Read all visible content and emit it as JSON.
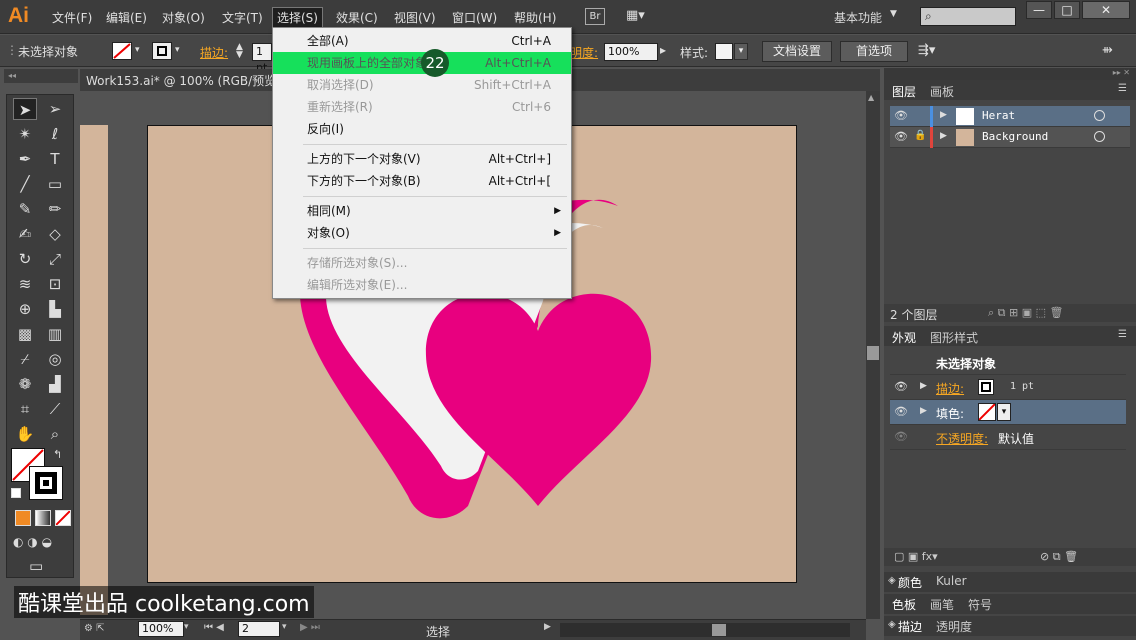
{
  "app": {
    "logo": "Ai"
  },
  "menubar": {
    "items": [
      "文件(F)",
      "编辑(E)",
      "对象(O)",
      "文字(T)",
      "选择(S)",
      "效果(C)",
      "视图(V)",
      "窗口(W)",
      "帮助(H)"
    ],
    "br_label": "Br",
    "workspace": "基本功能",
    "search_value": ""
  },
  "control": {
    "selection_label": "未选择对象",
    "stroke_label": "描边:",
    "stroke_value": "1 pt",
    "opacity_label": "不透明度:",
    "opacity_short": "明度:",
    "opacity_value": "100%",
    "style_label": "样式:",
    "doc_settings": "文档设置",
    "prefs": "首选项"
  },
  "document": {
    "title": "Work153.ai* @ 100% (RGB/预览"
  },
  "select_menu": {
    "items": [
      {
        "label": "全部(A)",
        "shortcut": "Ctrl+A",
        "state": "normal"
      },
      {
        "label": "现用画板上的全部对象(L)",
        "shortcut": "Alt+Ctrl+A",
        "state": "highlight"
      },
      {
        "label": "取消选择(D)",
        "shortcut": "Shift+Ctrl+A",
        "state": "disabled"
      },
      {
        "label": "重新选择(R)",
        "shortcut": "Ctrl+6",
        "state": "disabled"
      },
      {
        "label": "反向(I)",
        "shortcut": "",
        "state": "normal"
      },
      {
        "label": "上方的下一个对象(V)",
        "shortcut": "Alt+Ctrl+]",
        "state": "normal"
      },
      {
        "label": "下方的下一个对象(B)",
        "shortcut": "Alt+Ctrl+[",
        "state": "normal"
      },
      {
        "label": "相同(M)",
        "shortcut": "",
        "state": "submenu"
      },
      {
        "label": "对象(O)",
        "shortcut": "",
        "state": "submenu"
      },
      {
        "label": "存储所选对象(S)...",
        "shortcut": "",
        "state": "disabled"
      },
      {
        "label": "编辑所选对象(E)...",
        "shortcut": "",
        "state": "disabled"
      }
    ],
    "step_badge": "22"
  },
  "layers_panel": {
    "tabs": [
      "图层",
      "画板"
    ],
    "layers": [
      {
        "name": "Herat",
        "color": "#4a90e2"
      },
      {
        "name": "Background",
        "color": "#e0443c"
      }
    ],
    "count": "2 个图层"
  },
  "appearance_panel": {
    "tabs": [
      "外观",
      "图形样式"
    ],
    "header": "未选择对象",
    "stroke_label": "描边:",
    "stroke_value": "1 pt",
    "fill_label": "填色:",
    "opacity_label": "不透明度:",
    "opacity_value": "默认值"
  },
  "collapsed_panels": {
    "row1": [
      "颜色",
      "Kuler"
    ],
    "row2": [
      "色板",
      "画笔",
      "符号"
    ],
    "row3": [
      "描边",
      "透明度"
    ]
  },
  "statusbar": {
    "zoom": "100%",
    "artboard": "2",
    "tool": "选择"
  },
  "watermark": {
    "text": "酷课堂出品 coolketang.com"
  },
  "colors": {
    "heart": "#e8007f",
    "artboard": "#d3b59b",
    "highlight": "#16e05b"
  }
}
